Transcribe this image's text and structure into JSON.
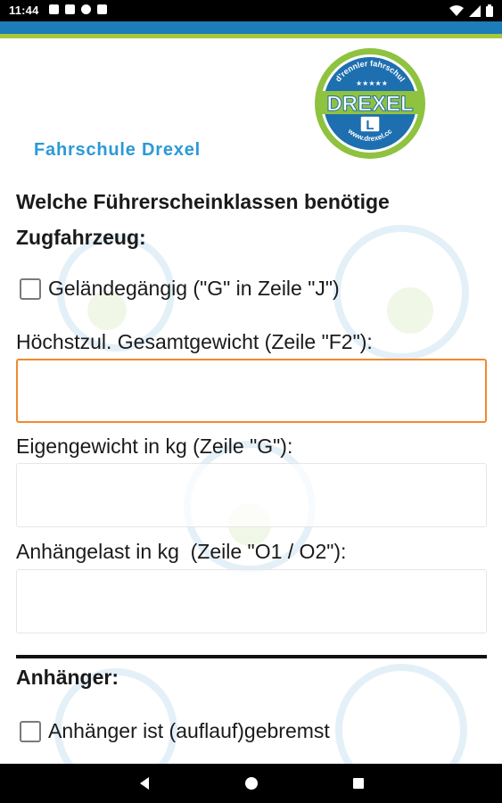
{
  "status_bar": {
    "time": "11:44",
    "notification_icons": [
      "notification-icon",
      "notification-icon",
      "notification-icon",
      "notification-icon"
    ],
    "system_icons": [
      "wifi-icon",
      "signal-icon",
      "battery-icon"
    ]
  },
  "header": {
    "school_name": "Fahrschule Drexel",
    "logo": {
      "top_arc_text": "d'rennler fahrschul",
      "brand": "DREXEL",
      "badge_letter": "L",
      "bottom_arc_text": "www.drexel.cc"
    }
  },
  "form": {
    "section_title": "Welche Führerscheinklassen benötige Zugfahrzeug:",
    "offroad_checkbox_label": "Geländegängig (\"G\" in Zeile \"J\")",
    "max_weight_label": "Höchstzul. Gesamtgewicht (Zeile \"F2\"):",
    "max_weight_value": "",
    "own_weight_label": "Eigengewicht in kg (Zeile \"G\"):",
    "own_weight_value": "",
    "trailer_load_label": "Anhängelast in kg  (Zeile \"O1 / O2\"):",
    "trailer_load_value": "",
    "trailer_heading": "Anhänger:",
    "trailer_braked_label": "Anhänger ist (auflauf)gebremst"
  },
  "colors": {
    "accent_blue": "#1d7db8",
    "accent_green": "#a6c83a",
    "school_name_blue": "#2a9ad8",
    "focus_orange": "#f08a2c"
  },
  "nav_bar": {
    "buttons": [
      "back-icon",
      "home-icon",
      "recents-icon"
    ]
  }
}
